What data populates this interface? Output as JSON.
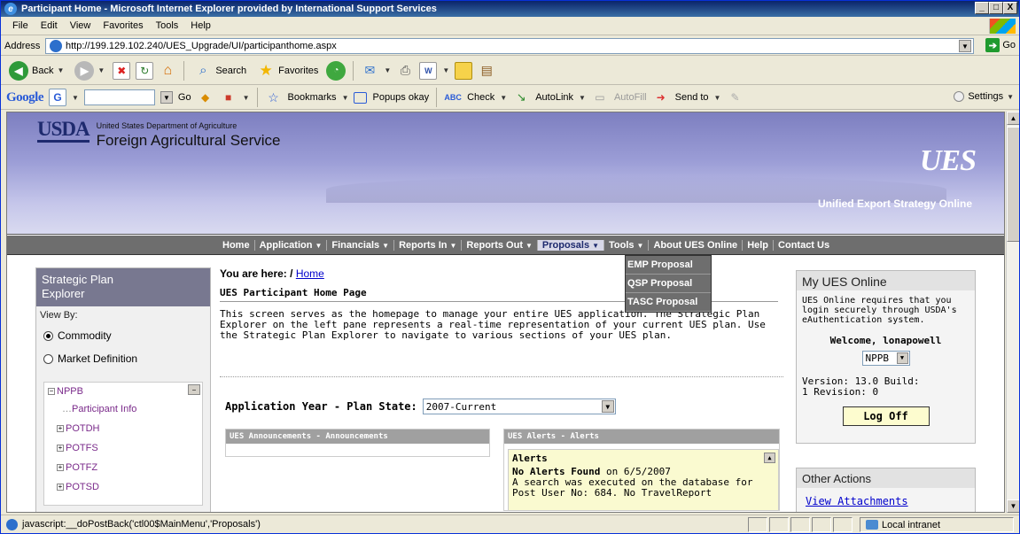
{
  "window": {
    "title": "Participant Home - Microsoft Internet Explorer provided by International Support Services",
    "minimize": "_",
    "maximize": "□",
    "close": "X"
  },
  "menubar": {
    "items": [
      "File",
      "Edit",
      "View",
      "Favorites",
      "Tools",
      "Help"
    ]
  },
  "addressbar": {
    "label": "Address",
    "url": "http://199.129.102.240/UES_Upgrade/UI/participanthome.aspx",
    "go": "Go"
  },
  "toolbar": {
    "back": "Back",
    "search": "Search",
    "favorites": "Favorites"
  },
  "googlebar": {
    "brand": "Google",
    "g_button": "G",
    "go": "Go",
    "bookmarks": "Bookmarks",
    "popups": "Popups okay",
    "check": "Check",
    "autolink": "AutoLink",
    "autofill": "AutoFill",
    "sendto": "Send to",
    "settings": "Settings"
  },
  "banner": {
    "logo": "USDA",
    "department": "United States Department of Agriculture",
    "agency": "Foreign Agricultural Service",
    "ues_logo": "UES",
    "ues_tagline": "Unified Export Strategy",
    "ues_tagline_bold": "Online"
  },
  "nav": {
    "items": [
      {
        "label": "Home",
        "arrow": ""
      },
      {
        "label": "Application",
        "arrow": "▼"
      },
      {
        "label": "Financials",
        "arrow": "▼"
      },
      {
        "label": "Reports In",
        "arrow": "▼"
      },
      {
        "label": "Reports Out",
        "arrow": "▼"
      },
      {
        "label": "Proposals",
        "arrow": "▼"
      },
      {
        "label": "Tools",
        "arrow": "▼"
      },
      {
        "label": "About UES Online",
        "arrow": ""
      },
      {
        "label": "Help",
        "arrow": ""
      },
      {
        "label": "Contact Us",
        "arrow": ""
      }
    ],
    "dropdown": [
      "EMP Proposal",
      "QSP Proposal",
      "TASC Proposal"
    ]
  },
  "explorer": {
    "title_line1": "Strategic Plan",
    "title_line2": "Explorer",
    "view_by": "View By:",
    "option_commodity": "Commodity",
    "option_market": "Market Definition",
    "tree": [
      "NPPB",
      "Participant Info",
      "POTDH",
      "POTFS",
      "POTFZ",
      "POTSD"
    ]
  },
  "main": {
    "breadcrumb_label": "You are here: /",
    "breadcrumb_link": "Home",
    "heading": "UES Participant Home Page",
    "intro": "This screen serves as the homepage to manage your entire UES application. The Strategic Plan Explorer on the left pane represents a real-time representation of your current UES plan. Use the Strategic Plan Explorer to navigate to various sections of your UES plan.",
    "plan_label": "Application Year - Plan State:",
    "plan_value": "2007-Current",
    "announcements_head": "UES Announcements - Announcements",
    "alerts_head": "UES Alerts - Alerts",
    "alerts_title": "Alerts",
    "alerts_none": "No Alerts Found",
    "alerts_date": "on 6/5/2007",
    "alerts_text": "A search was executed on the database for Post User No: 684. No TravelReport"
  },
  "right": {
    "title": "My UES Online",
    "message": "UES Online requires that you login securely through USDA's eAuthentication system.",
    "welcome": "Welcome, lonapowell",
    "org": "NPPB",
    "version_line1": "Version: 13.0 Build:",
    "version_line2": "1 Revision: 0",
    "logoff": "Log Off",
    "other_title": "Other Actions",
    "view_attachments": "View Attachments"
  },
  "status": {
    "text": "javascript:__doPostBack('ctl00$MainMenu','Proposals')",
    "zone": "Local intranet"
  }
}
